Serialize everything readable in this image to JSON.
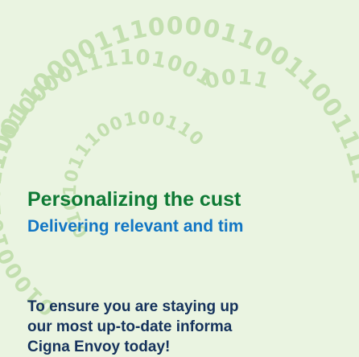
{
  "hero": {
    "headline": "Personalizing the cust",
    "subheadline": "Delivering relevant and tim",
    "body_lines": [
      "To ensure you are staying up",
      "our most up-to-date informa",
      "Cigna Envoy today!"
    ]
  },
  "background": {
    "binary_outer": "0010100110000111000011001100111100001",
    "binary_inner": "0100010101110100001111010010011",
    "binary_center": "0101011100100110",
    "colors": {
      "page": "#eaf4e1",
      "digits": "#c3dfaf"
    }
  },
  "colors": {
    "headline": "#0f7a35",
    "subheadline": "#1276c4",
    "body": "#15325c"
  }
}
